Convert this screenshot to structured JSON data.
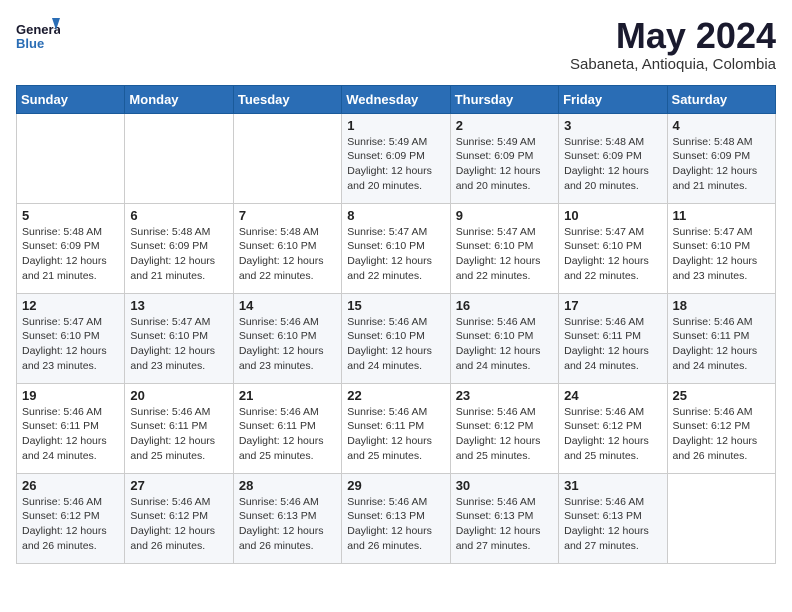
{
  "logo": {
    "line1": "General",
    "line2": "Blue"
  },
  "title": "May 2024",
  "location": "Sabaneta, Antioquia, Colombia",
  "weekdays": [
    "Sunday",
    "Monday",
    "Tuesday",
    "Wednesday",
    "Thursday",
    "Friday",
    "Saturday"
  ],
  "weeks": [
    [
      {
        "day": "",
        "info": ""
      },
      {
        "day": "",
        "info": ""
      },
      {
        "day": "",
        "info": ""
      },
      {
        "day": "1",
        "info": "Sunrise: 5:49 AM\nSunset: 6:09 PM\nDaylight: 12 hours\nand 20 minutes."
      },
      {
        "day": "2",
        "info": "Sunrise: 5:49 AM\nSunset: 6:09 PM\nDaylight: 12 hours\nand 20 minutes."
      },
      {
        "day": "3",
        "info": "Sunrise: 5:48 AM\nSunset: 6:09 PM\nDaylight: 12 hours\nand 20 minutes."
      },
      {
        "day": "4",
        "info": "Sunrise: 5:48 AM\nSunset: 6:09 PM\nDaylight: 12 hours\nand 21 minutes."
      }
    ],
    [
      {
        "day": "5",
        "info": "Sunrise: 5:48 AM\nSunset: 6:09 PM\nDaylight: 12 hours\nand 21 minutes."
      },
      {
        "day": "6",
        "info": "Sunrise: 5:48 AM\nSunset: 6:09 PM\nDaylight: 12 hours\nand 21 minutes."
      },
      {
        "day": "7",
        "info": "Sunrise: 5:48 AM\nSunset: 6:10 PM\nDaylight: 12 hours\nand 22 minutes."
      },
      {
        "day": "8",
        "info": "Sunrise: 5:47 AM\nSunset: 6:10 PM\nDaylight: 12 hours\nand 22 minutes."
      },
      {
        "day": "9",
        "info": "Sunrise: 5:47 AM\nSunset: 6:10 PM\nDaylight: 12 hours\nand 22 minutes."
      },
      {
        "day": "10",
        "info": "Sunrise: 5:47 AM\nSunset: 6:10 PM\nDaylight: 12 hours\nand 22 minutes."
      },
      {
        "day": "11",
        "info": "Sunrise: 5:47 AM\nSunset: 6:10 PM\nDaylight: 12 hours\nand 23 minutes."
      }
    ],
    [
      {
        "day": "12",
        "info": "Sunrise: 5:47 AM\nSunset: 6:10 PM\nDaylight: 12 hours\nand 23 minutes."
      },
      {
        "day": "13",
        "info": "Sunrise: 5:47 AM\nSunset: 6:10 PM\nDaylight: 12 hours\nand 23 minutes."
      },
      {
        "day": "14",
        "info": "Sunrise: 5:46 AM\nSunset: 6:10 PM\nDaylight: 12 hours\nand 23 minutes."
      },
      {
        "day": "15",
        "info": "Sunrise: 5:46 AM\nSunset: 6:10 PM\nDaylight: 12 hours\nand 24 minutes."
      },
      {
        "day": "16",
        "info": "Sunrise: 5:46 AM\nSunset: 6:10 PM\nDaylight: 12 hours\nand 24 minutes."
      },
      {
        "day": "17",
        "info": "Sunrise: 5:46 AM\nSunset: 6:11 PM\nDaylight: 12 hours\nand 24 minutes."
      },
      {
        "day": "18",
        "info": "Sunrise: 5:46 AM\nSunset: 6:11 PM\nDaylight: 12 hours\nand 24 minutes."
      }
    ],
    [
      {
        "day": "19",
        "info": "Sunrise: 5:46 AM\nSunset: 6:11 PM\nDaylight: 12 hours\nand 24 minutes."
      },
      {
        "day": "20",
        "info": "Sunrise: 5:46 AM\nSunset: 6:11 PM\nDaylight: 12 hours\nand 25 minutes."
      },
      {
        "day": "21",
        "info": "Sunrise: 5:46 AM\nSunset: 6:11 PM\nDaylight: 12 hours\nand 25 minutes."
      },
      {
        "day": "22",
        "info": "Sunrise: 5:46 AM\nSunset: 6:11 PM\nDaylight: 12 hours\nand 25 minutes."
      },
      {
        "day": "23",
        "info": "Sunrise: 5:46 AM\nSunset: 6:12 PM\nDaylight: 12 hours\nand 25 minutes."
      },
      {
        "day": "24",
        "info": "Sunrise: 5:46 AM\nSunset: 6:12 PM\nDaylight: 12 hours\nand 25 minutes."
      },
      {
        "day": "25",
        "info": "Sunrise: 5:46 AM\nSunset: 6:12 PM\nDaylight: 12 hours\nand 26 minutes."
      }
    ],
    [
      {
        "day": "26",
        "info": "Sunrise: 5:46 AM\nSunset: 6:12 PM\nDaylight: 12 hours\nand 26 minutes."
      },
      {
        "day": "27",
        "info": "Sunrise: 5:46 AM\nSunset: 6:12 PM\nDaylight: 12 hours\nand 26 minutes."
      },
      {
        "day": "28",
        "info": "Sunrise: 5:46 AM\nSunset: 6:13 PM\nDaylight: 12 hours\nand 26 minutes."
      },
      {
        "day": "29",
        "info": "Sunrise: 5:46 AM\nSunset: 6:13 PM\nDaylight: 12 hours\nand 26 minutes."
      },
      {
        "day": "30",
        "info": "Sunrise: 5:46 AM\nSunset: 6:13 PM\nDaylight: 12 hours\nand 27 minutes."
      },
      {
        "day": "31",
        "info": "Sunrise: 5:46 AM\nSunset: 6:13 PM\nDaylight: 12 hours\nand 27 minutes."
      },
      {
        "day": "",
        "info": ""
      }
    ]
  ]
}
